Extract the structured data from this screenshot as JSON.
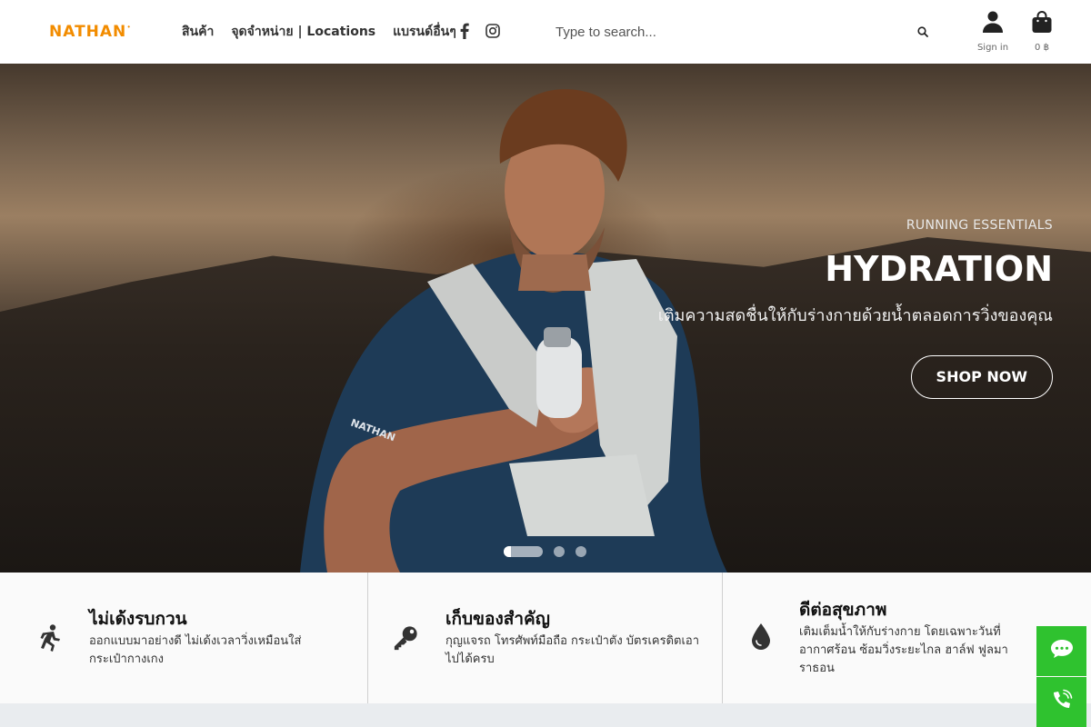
{
  "header": {
    "logo": "NATHAN",
    "nav": [
      {
        "label": "สินค้า"
      },
      {
        "label": "จุดจำหน่าย | Locations"
      },
      {
        "label": "แบรนด์อื่นๆ"
      }
    ],
    "social": [
      {
        "icon": "facebook-icon"
      },
      {
        "icon": "instagram-icon"
      }
    ],
    "search": {
      "placeholder": "Type to search...",
      "icon": "search-icon"
    },
    "account": {
      "label": "Sign in",
      "icon": "user-icon"
    },
    "cart": {
      "label": "0 ฿",
      "icon": "shopping-bag-icon"
    }
  },
  "hero": {
    "kicker": "RUNNING ESSENTIALS",
    "title": "HYDRATION",
    "subtitle": "เติมความสดชื่นให้กับร่างกายด้วยน้ำตลอดการวิ่งของคุณ",
    "button": "SHOP NOW",
    "brand_on_shirt": "NATHAN",
    "slides": 3,
    "active_slide": 1
  },
  "features": [
    {
      "icon": "running-person-icon",
      "title": "ไม่เด้งรบกวน",
      "description": "ออกแบบมาอย่างดี ไม่เด้งเวลาวิ่งเหมือนใส่กระเป๋ากางเกง"
    },
    {
      "icon": "key-icon",
      "title": "เก็บของสำคัญ",
      "description": "กุญแจรถ โทรศัพท์มือถือ กระเป๋าตัง บัตรเครดิตเอาไปได้ครบ"
    },
    {
      "icon": "water-drop-icon",
      "title": "ดีต่อสุขภาพ",
      "description": "เติมเต็มน้ำให้กับร่างกาย โดยเฉพาะวันที่อากาศร้อน ซ้อมวิ่งระยะไกล ฮาล์ฟ ฟูลมาราธอน"
    }
  ],
  "floating": [
    {
      "icon": "chat-icon"
    },
    {
      "icon": "phone-icon"
    }
  ],
  "colors": {
    "brand": "#f28c00",
    "float": "#2fc22f"
  }
}
